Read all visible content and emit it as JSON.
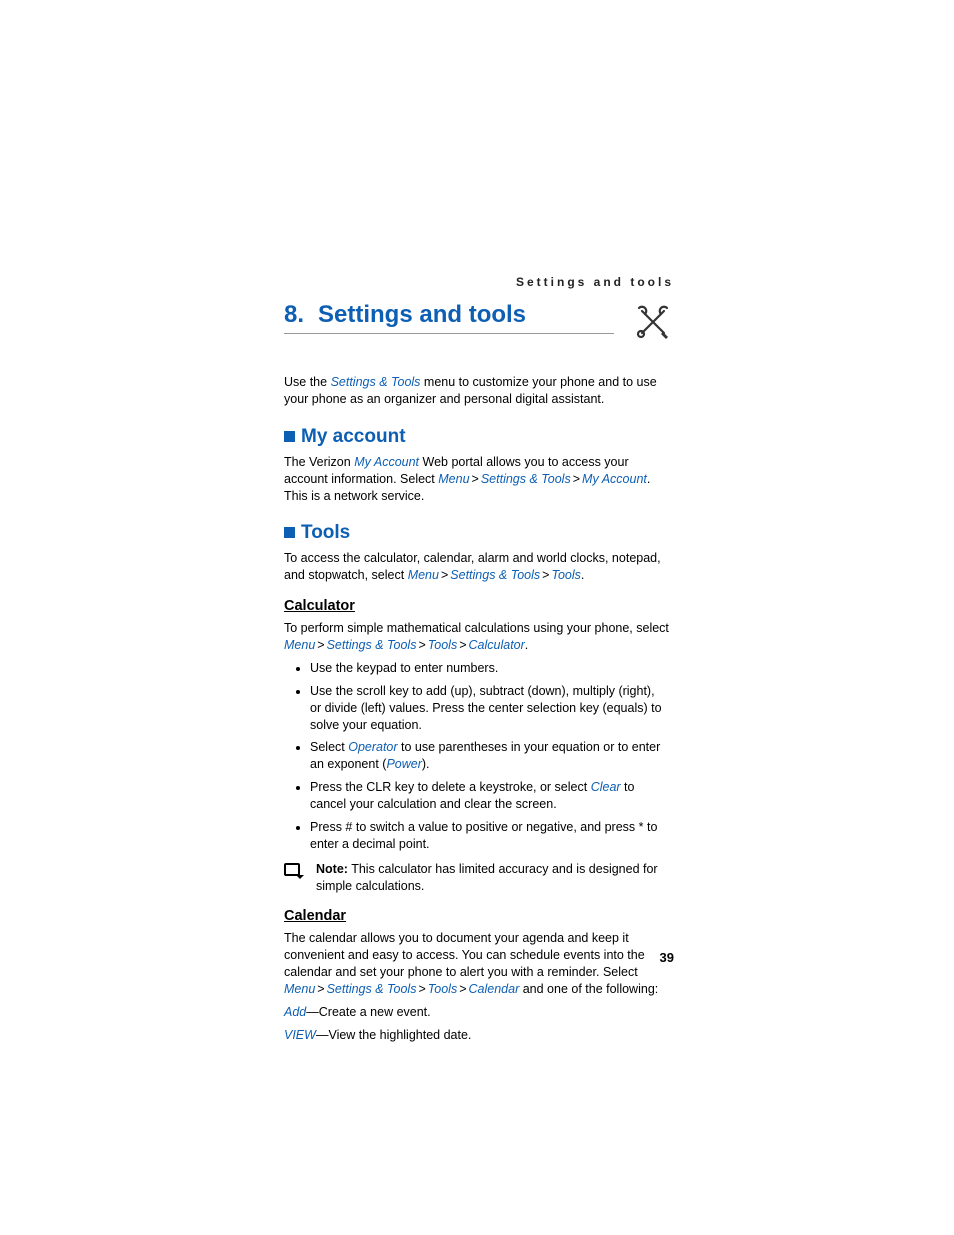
{
  "header": "Settings and tools",
  "chapter_number": "8.",
  "chapter_title": "Settings and tools",
  "intro": {
    "pre": "Use the ",
    "link": "Settings & Tools",
    "post": " menu to customize your phone and to use your phone as an organizer and personal digital assistant."
  },
  "myaccount": {
    "title": "My account",
    "pre": "The Verizon ",
    "link1": "My Account",
    "mid": " Web portal allows you to access your account information. Select ",
    "menu": "Menu",
    "st": "Settings & Tools",
    "ma": "My Account",
    "post": ". This is a network service."
  },
  "tools": {
    "title": "Tools",
    "pre": "To access the calculator, calendar, alarm and world clocks, notepad, and stopwatch, select ",
    "menu": "Menu",
    "st": "Settings & Tools",
    "t": "Tools",
    "post": "."
  },
  "calculator": {
    "title": "Calculator",
    "pre": "To perform simple mathematical calculations using your phone, select ",
    "menu": "Menu",
    "st": "Settings & Tools",
    "t": "Tools",
    "c": "Calculator",
    "post": ".",
    "b1": "Use the keypad to enter numbers.",
    "b2": "Use the scroll key to add (up), subtract (down), multiply (right), or divide (left) values. Press the center selection key (equals) to solve your equation.",
    "b3_pre": "Select ",
    "b3_link1": "Operator",
    "b3_mid": " to use parentheses in your equation or to enter an exponent (",
    "b3_link2": "Power",
    "b3_post": ").",
    "b4_pre": "Press the CLR key to delete a keystroke, or select ",
    "b4_link": "Clear",
    "b4_post": " to cancel your calculation and clear the screen.",
    "b5": "Press # to switch a value to positive or negative, and press * to enter a decimal point.",
    "note_label": "Note:",
    "note_text": " This calculator has limited accuracy and is designed for simple calculations."
  },
  "calendar": {
    "title": "Calendar",
    "pre": "The calendar allows you to document your agenda and keep it convenient and easy to access. You can schedule events into the calendar and set your phone to alert you with a reminder. Select ",
    "menu": "Menu",
    "st": "Settings & Tools",
    "t": "Tools",
    "c": "Calendar",
    "post": " and one of the following:",
    "add": "Add",
    "add_text": "—Create a new event.",
    "view": "VIEW",
    "view_text": "—View the highlighted date."
  },
  "gt": ">",
  "pagenum": "39"
}
